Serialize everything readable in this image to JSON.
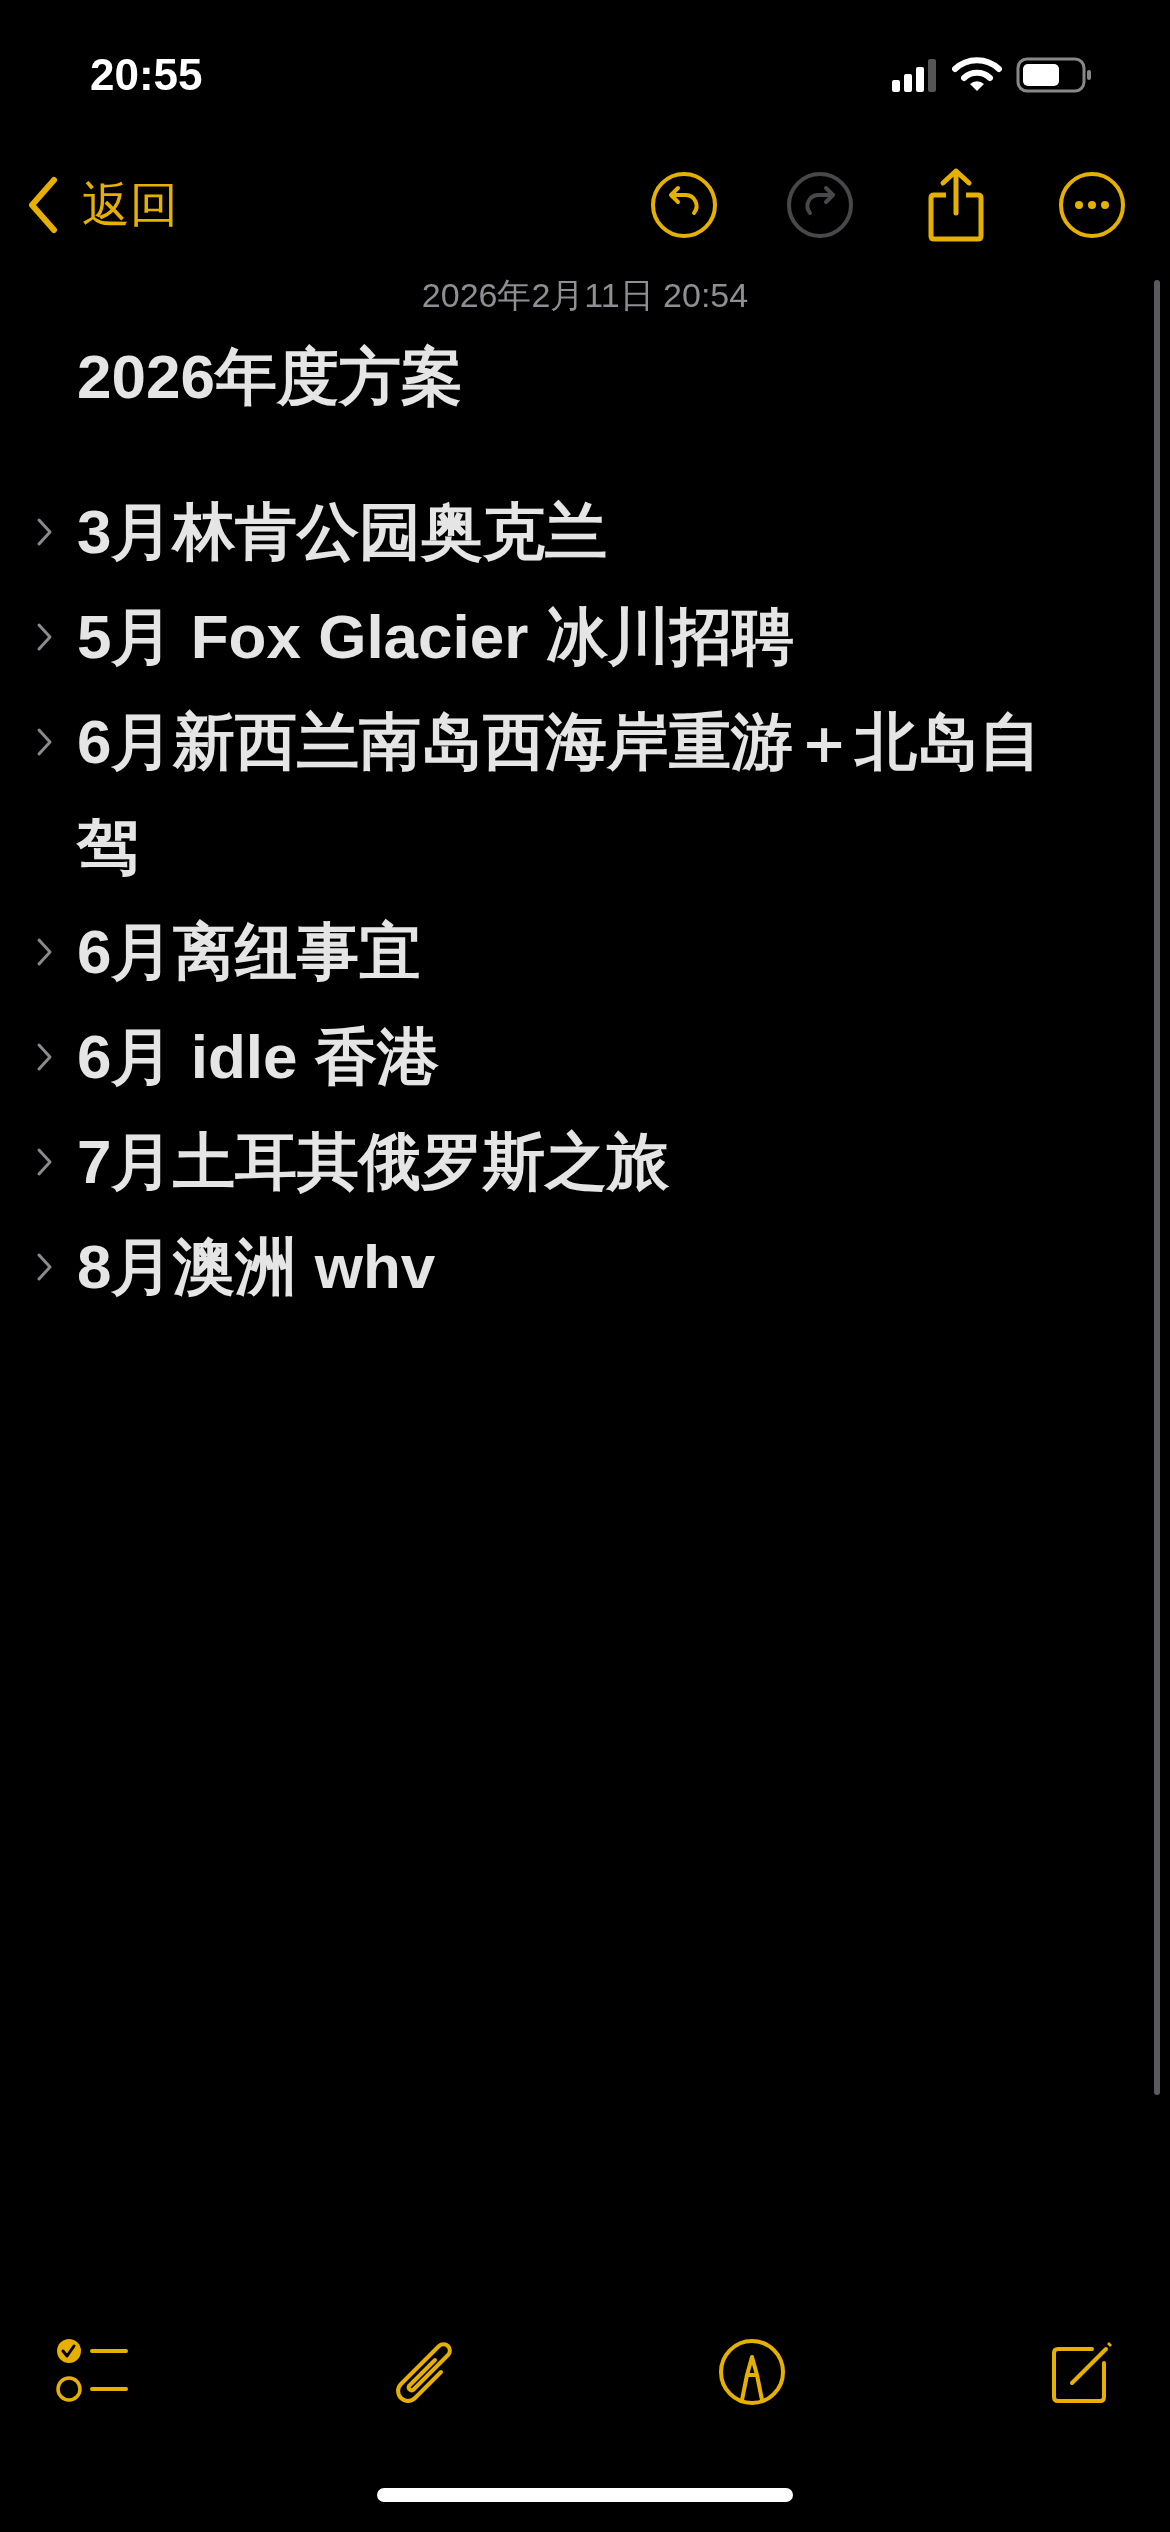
{
  "status_bar": {
    "time": "20:55"
  },
  "nav": {
    "back_label": "返回",
    "undo": {
      "disabled": false
    },
    "redo": {
      "disabled": true
    }
  },
  "note": {
    "date": "2026年2月11日 20:54",
    "title": "2026年度方案",
    "items": [
      {
        "text": "3月林肯公园奥克兰",
        "expanded": false
      },
      {
        "text": "5月 Fox Glacier 冰川招聘",
        "expanded": false
      },
      {
        "text": "6月新西兰南岛西海岸重游＋北岛自驾",
        "expanded": false
      },
      {
        "text": "6月离纽事宜",
        "expanded": false
      },
      {
        "text": "6月 idle 香港",
        "expanded": false
      },
      {
        "text": "7月土耳其俄罗斯之旅",
        "expanded": false
      },
      {
        "text": "8月澳洲 whv",
        "expanded": false
      }
    ]
  }
}
